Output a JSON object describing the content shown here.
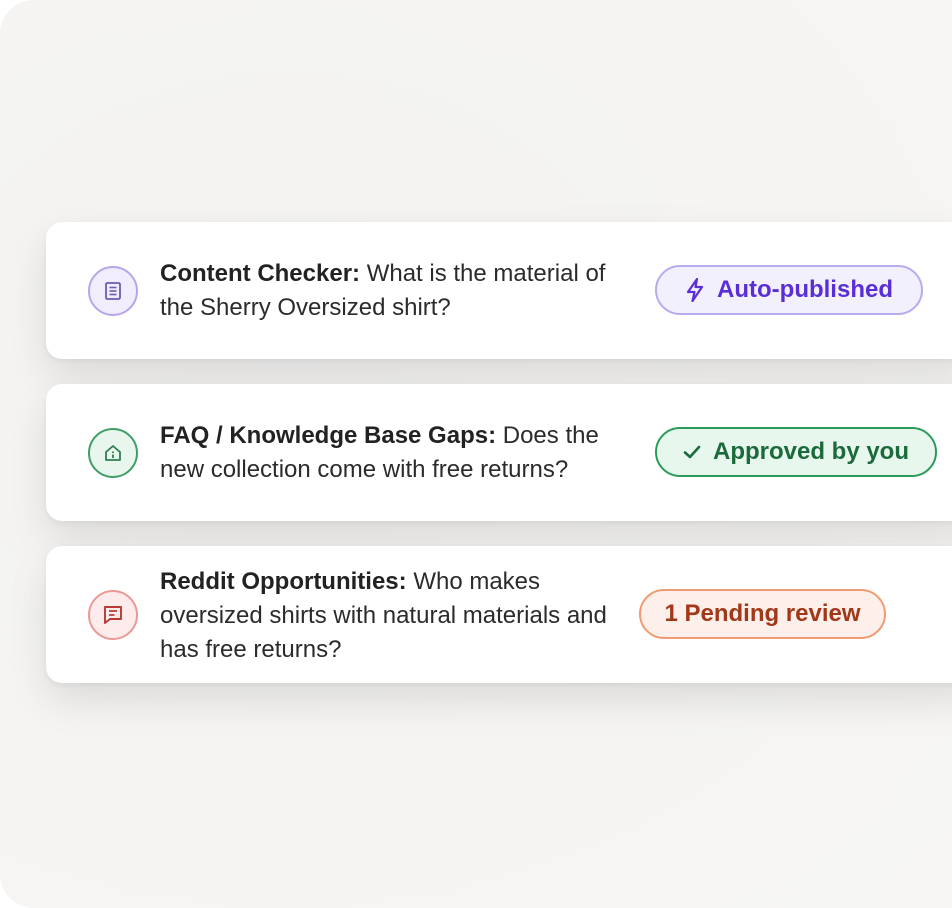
{
  "items": [
    {
      "category": "Content Checker:",
      "question": "What is the material of the Sherry Oversized shirt?",
      "icon": "document-icon",
      "status": "Auto-published",
      "status_icon": "lightning-icon",
      "color": "#5a2ed6"
    },
    {
      "category": "FAQ / Knowledge Base Gaps:",
      "question": "Does the new collection come with free returns?",
      "icon": "home-info-icon",
      "status": "Approved by you",
      "status_icon": "check-icon",
      "color": "#1b6a3b"
    },
    {
      "category": "Reddit Opportunities:",
      "question": "Who makes oversized shirts with natural materials and has free returns?",
      "icon": "message-icon",
      "status": "1 Pending review",
      "status_icon": "",
      "color": "#a2381a"
    }
  ]
}
